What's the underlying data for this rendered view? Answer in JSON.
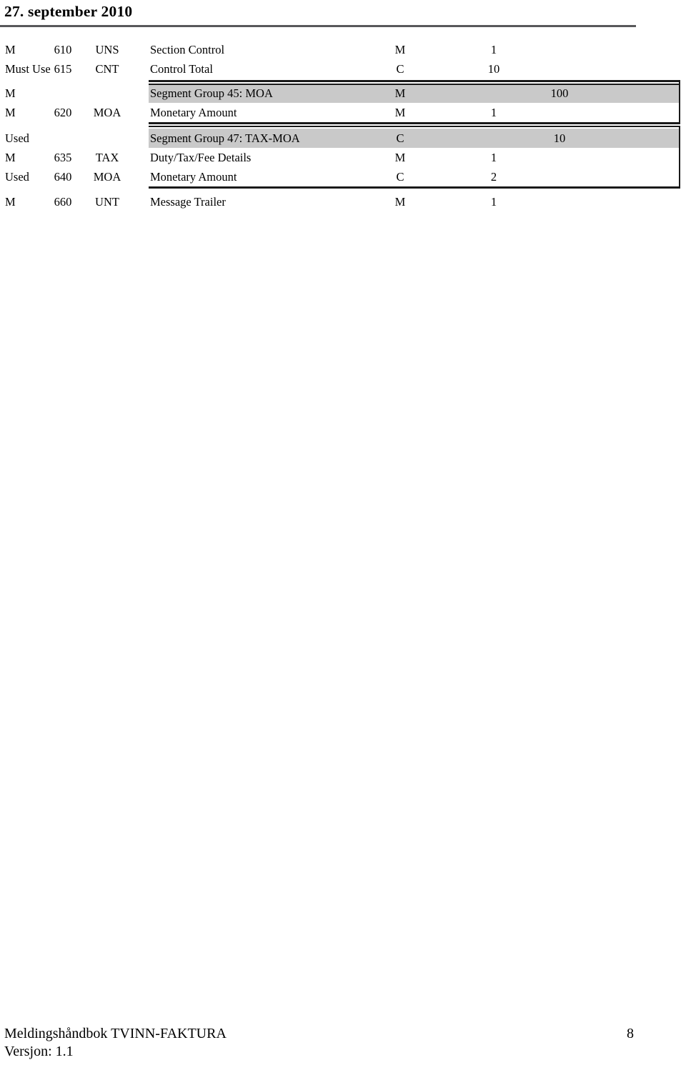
{
  "header": {
    "date": "27. september 2010"
  },
  "table": {
    "rows": [
      {
        "kind": "segment",
        "status": "M",
        "number": "610",
        "code": "UNS",
        "description": "Section Control",
        "mc": "M",
        "max_use": "1"
      },
      {
        "kind": "segment",
        "status": "Must Use",
        "number": "615",
        "code": "CNT",
        "description": "Control Total",
        "mc": "C",
        "max_use": "10"
      },
      {
        "kind": "group",
        "status": "M",
        "number": "",
        "code": "",
        "description": "Segment Group 45: MOA",
        "mc": "M",
        "max_use": "100"
      },
      {
        "kind": "segment",
        "status": "M",
        "number": "620",
        "code": "MOA",
        "description": "Monetary Amount",
        "mc": "M",
        "max_use": "1"
      },
      {
        "kind": "group",
        "status": "Used",
        "number": "",
        "code": "",
        "description": "Segment Group 47: TAX-MOA",
        "mc": "C",
        "max_use": "10"
      },
      {
        "kind": "segment",
        "status": "M",
        "number": "635",
        "code": "TAX",
        "description": "Duty/Tax/Fee Details",
        "mc": "M",
        "max_use": "1"
      },
      {
        "kind": "segment",
        "status": "Used",
        "number": "640",
        "code": "MOA",
        "description": "Monetary Amount",
        "mc": "C",
        "max_use": "2"
      },
      {
        "kind": "segment",
        "status": "M",
        "number": "660",
        "code": "UNT",
        "description": "Message Trailer",
        "mc": "M",
        "max_use": "1"
      }
    ]
  },
  "footer": {
    "line1": "Meldingshåndbok TVINN-FAKTURA",
    "line2": "Versjon: 1.1",
    "page_number": "8"
  },
  "colors": {
    "band": "#c9c9c9",
    "rule": "#1a1a1a",
    "header_rule": "#58585a",
    "text": "#000000"
  }
}
